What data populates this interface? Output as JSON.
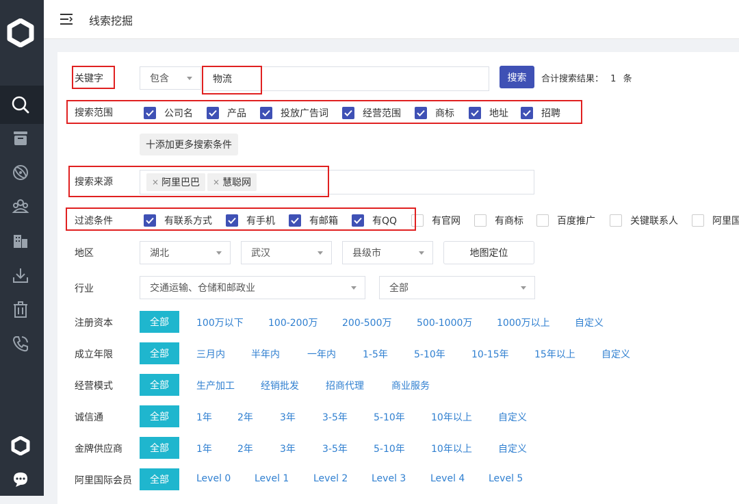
{
  "header": {
    "title": "线索挖掘"
  },
  "sidebar": {
    "icons": [
      "logo-icon",
      "search-icon",
      "archive-icon",
      "orbit-icon",
      "users-icon",
      "building-icon",
      "download-icon",
      "trash-icon",
      "phone-icon",
      "brand-icon",
      "chat-icon"
    ]
  },
  "keyword": {
    "label": "关键字",
    "match_value": "包含",
    "input_value": "物流",
    "search_button": "搜索",
    "result_text": "合计搜索结果：",
    "result_count": "1",
    "result_unit": "条"
  },
  "scope": {
    "label": "搜索范围",
    "options": [
      {
        "label": "公司名",
        "checked": true
      },
      {
        "label": "产品",
        "checked": true
      },
      {
        "label": "投放广告词",
        "checked": true
      },
      {
        "label": "经营范围",
        "checked": true
      },
      {
        "label": "商标",
        "checked": true
      },
      {
        "label": "地址",
        "checked": true
      },
      {
        "label": "招聘",
        "checked": true
      }
    ]
  },
  "add_condition": "十添加更多搜索条件",
  "source": {
    "label": "搜索来源",
    "tags": [
      "阿里巴巴",
      "慧聪网"
    ]
  },
  "filter": {
    "label": "过滤条件",
    "options": [
      {
        "label": "有联系方式",
        "checked": true
      },
      {
        "label": "有手机",
        "checked": true
      },
      {
        "label": "有邮箱",
        "checked": true
      },
      {
        "label": "有QQ",
        "checked": true
      },
      {
        "label": "有官网",
        "checked": false
      },
      {
        "label": "有商标",
        "checked": false
      },
      {
        "label": "百度推广",
        "checked": false
      },
      {
        "label": "关键联系人",
        "checked": false
      },
      {
        "label": "阿里国",
        "checked": false
      }
    ]
  },
  "region": {
    "label": "地区",
    "province": "湖北",
    "city": "武汉",
    "county": "县级市",
    "map_button": "地图定位"
  },
  "industry": {
    "label": "行业",
    "category": "交通运输、仓储和邮政业",
    "sub": "全部"
  },
  "capital": {
    "label": "注册资本",
    "options": [
      "全部",
      "100万以下",
      "100-200万",
      "200-500万",
      "500-1000万",
      "1000万以上",
      "自定义"
    ]
  },
  "years": {
    "label": "成立年限",
    "options": [
      "全部",
      "三月内",
      "半年内",
      "一年内",
      "1-5年",
      "5-10年",
      "10-15年",
      "15年以上",
      "自定义"
    ]
  },
  "mode": {
    "label": "经营模式",
    "options": [
      "全部",
      "生产加工",
      "经销批发",
      "招商代理",
      "商业服务"
    ]
  },
  "trust": {
    "label": "诚信通",
    "options": [
      "全部",
      "1年",
      "2年",
      "3年",
      "3-5年",
      "5-10年",
      "10年以上",
      "自定义"
    ]
  },
  "gold": {
    "label": "金牌供应商",
    "options": [
      "全部",
      "1年",
      "2年",
      "3年",
      "3-5年",
      "5-10年",
      "10年以上",
      "自定义"
    ]
  },
  "intl": {
    "label": "阿里国际会员",
    "options": [
      "全部",
      "Level 0",
      "Level 1",
      "Level 2",
      "Level 3",
      "Level 4",
      "Level 5"
    ]
  },
  "colors": {
    "sidebar": "#2b323c",
    "primary": "#3f51b5",
    "active": "#1fb6ce",
    "link": "#2f7fd0",
    "highlight": "#e02020"
  }
}
